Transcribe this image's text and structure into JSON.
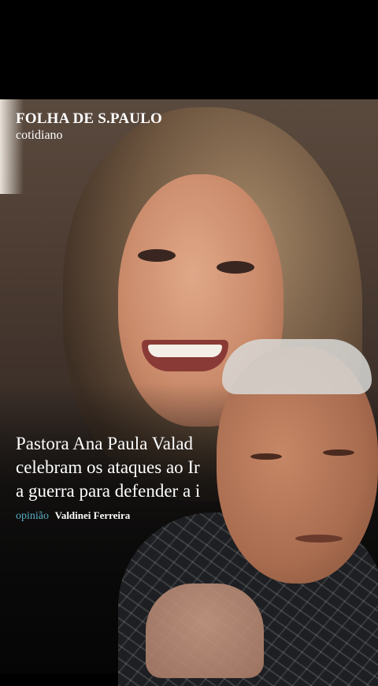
{
  "brand": {
    "name": "FOLHA DE S.PAULO",
    "section": "cotidiano"
  },
  "article": {
    "headline_lines": [
      "Pastora Ana Paula Valad",
      "celebram os ataques ao Ir",
      "a guerra para defender a i"
    ],
    "kicker": "opinião",
    "author": "Valdinei Ferreira"
  },
  "colors": {
    "kicker": "#5bb0c8",
    "background": "#000000"
  }
}
